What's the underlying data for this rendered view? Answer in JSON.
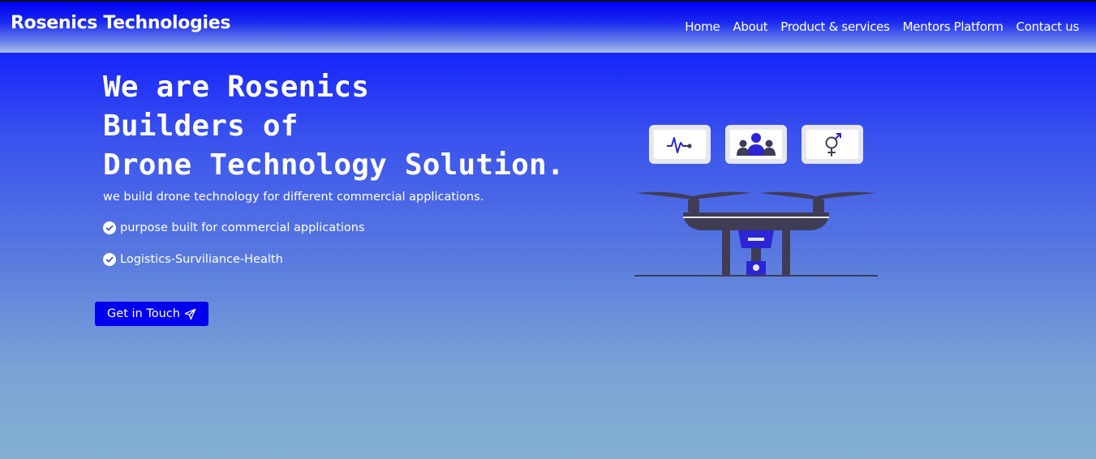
{
  "header": {
    "brand": "Rosenics Technologies",
    "nav": [
      "Home",
      "About",
      "Product & services",
      "Mentors Platform",
      "Contact us"
    ]
  },
  "hero": {
    "title_lines": [
      "We are Rosenics",
      "Builders of",
      "Drone Technology Solution."
    ],
    "subtitle": "we build drone technology for different commercial applications.",
    "features": [
      "purpose built for commercial applications",
      "Logistics-Surviliance-Health"
    ],
    "cta_label": "Get in Touch"
  },
  "illustration": {
    "cards": [
      "pulse-icon",
      "group-icon",
      "gender-icon"
    ]
  },
  "colors": {
    "nav_gradient_top": "#0000f0",
    "hero_top": "#0a14ff",
    "hero_bottom": "#84b0d2",
    "cta_bg": "#0000ee",
    "drone": "#3f3d56",
    "accent": "#2b25d6"
  },
  "icons": {
    "check": "check-circle-icon",
    "send": "send-icon"
  }
}
